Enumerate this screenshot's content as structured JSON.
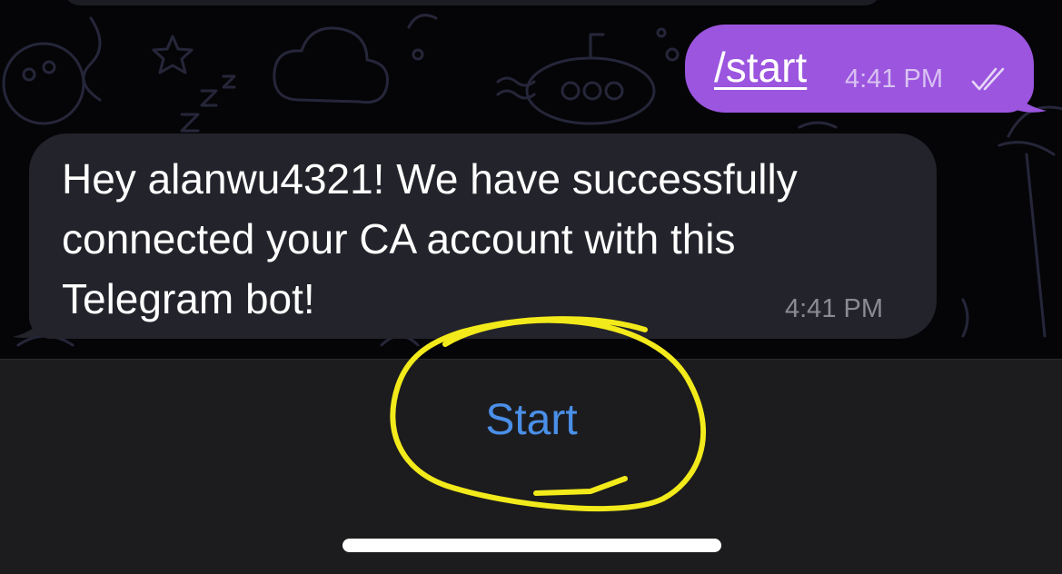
{
  "chat": {
    "outgoing": {
      "text": "/start",
      "time": "4:41 PM",
      "status_icon": "double-check-icon"
    },
    "incoming": {
      "lines": [
        "Hey alanwu4321! We have successfully",
        "connected your CA account with this",
        "Telegram bot!"
      ],
      "time": "4:41 PM"
    }
  },
  "bottom_bar": {
    "start_label": "Start"
  },
  "colors": {
    "outgoing_bubble": "#9b55de",
    "incoming_bubble": "#23232b",
    "start_button_text": "#4a8fe8",
    "annotation_circle": "#f2ea1a"
  }
}
